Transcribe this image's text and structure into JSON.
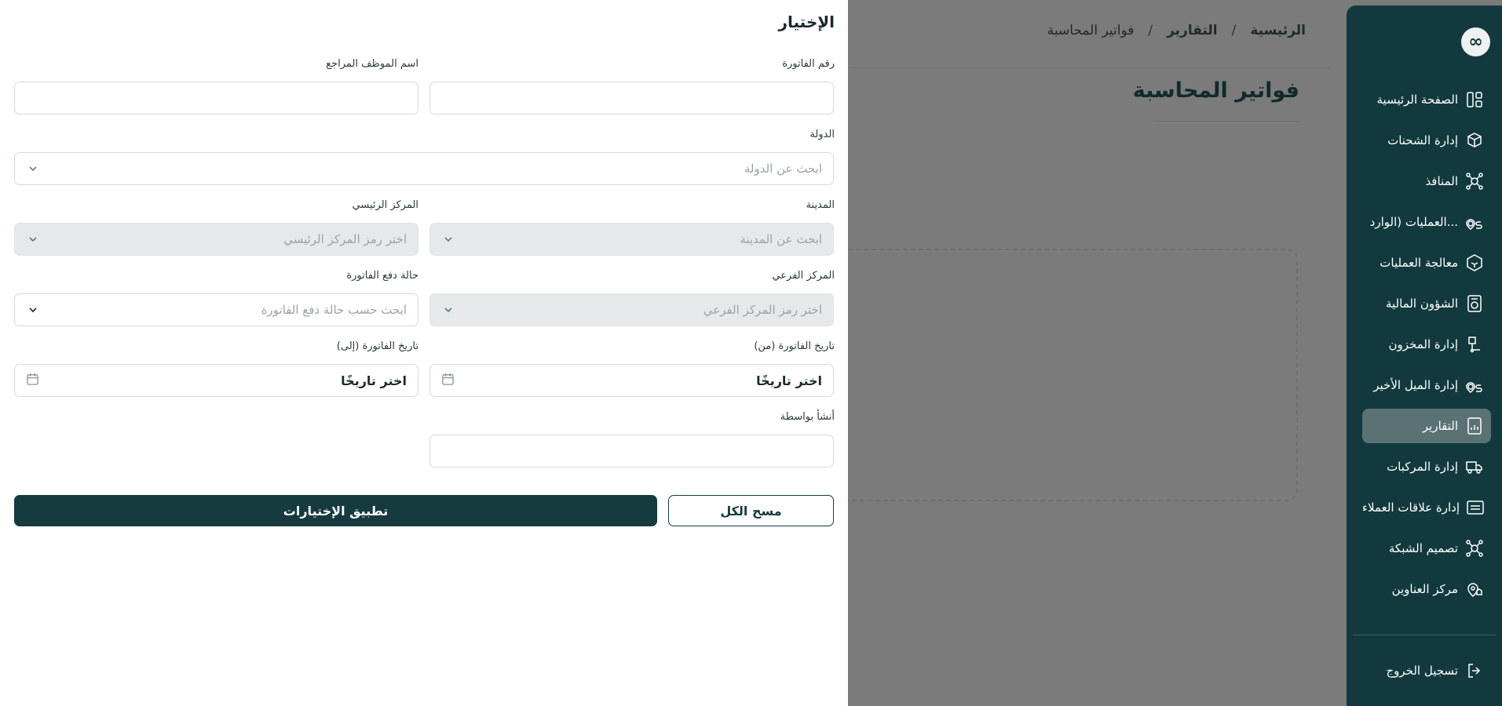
{
  "breadcrumb": {
    "home": "الرئيسية",
    "reports": "التقارير",
    "current": "فواتير المحاسبة",
    "separator": "/"
  },
  "page": {
    "title": "فواتير المحاسبة"
  },
  "sidebar": {
    "logo": "∞",
    "items": [
      {
        "label": "الصفحة الرئيسية",
        "icon": "dashboard-icon"
      },
      {
        "label": "إدارة الشحنات",
        "icon": "package-icon"
      },
      {
        "label": "المنافذ",
        "icon": "network-icon"
      },
      {
        "label": "العمليات (الوارد...",
        "icon": "route-icon"
      },
      {
        "label": "معالجة العمليات",
        "icon": "box-process-icon"
      },
      {
        "label": "الشؤون المالية",
        "icon": "finance-icon"
      },
      {
        "label": "إدارة المخزون",
        "icon": "warehouse-icon"
      },
      {
        "label": "إدارة الميل الأخير",
        "icon": "last-mile-icon"
      },
      {
        "label": "التقارير",
        "icon": "reports-icon",
        "active": true
      },
      {
        "label": "إدارة المركبات",
        "icon": "truck-icon"
      },
      {
        "label": "إدارة علاقات العملاء",
        "icon": "crm-icon"
      },
      {
        "label": "تصميم الشبكة",
        "icon": "network-design-icon"
      },
      {
        "label": "مركز العناوين",
        "icon": "address-pin-icon"
      }
    ],
    "logout": "تسجيل الخروج"
  },
  "filter": {
    "title": "الإختيار",
    "invoice_number": {
      "label": "رقم الفاتورة",
      "value": "",
      "placeholder": ""
    },
    "reviewer_name": {
      "label": "اسم الموظف المراجع",
      "value": "",
      "placeholder": ""
    },
    "country": {
      "label": "الدولة",
      "placeholder": "ابحث عن الدولة"
    },
    "city": {
      "label": "المدينة",
      "placeholder": "ابحث عن المدينة"
    },
    "main_center": {
      "label": "المركز الرئيسي",
      "placeholder": "اختر رمز المركز الرئيسي"
    },
    "sub_center": {
      "label": "المركز الفرعي",
      "placeholder": "اختر رمز المركز الفرعي"
    },
    "payment_status": {
      "label": "حالة دفع الفاتورة",
      "placeholder": "ابحث حسب حالة دفع الفاتورة"
    },
    "date_from": {
      "label": "تاريخ الفاتورة (من)",
      "placeholder": "اختر تاريخًا"
    },
    "date_to": {
      "label": "تاريخ الفاتورة (إلى)",
      "placeholder": "اختر تاريخًا"
    },
    "created_by": {
      "label": "أنشأ بواسطة",
      "value": "",
      "placeholder": ""
    },
    "clear_label": "مسح الكل",
    "apply_label": "تطبيق الإختيارات"
  }
}
